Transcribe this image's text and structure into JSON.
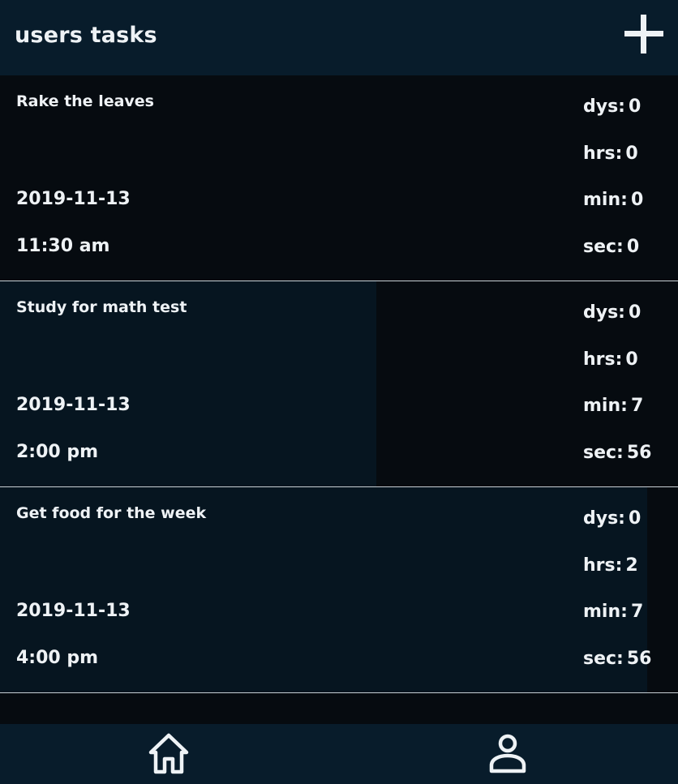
{
  "header": {
    "title": "users tasks",
    "add_icon": "plus-icon"
  },
  "colors": {
    "header_bg": "#081c2b",
    "page_bg": "#060b10",
    "elapsed_fill": "#061520",
    "text": "#eef2f5",
    "divider": "#c8cfd4"
  },
  "tasks": [
    {
      "name": "Rake the leaves",
      "date": "2019-11-13",
      "time": "11:30 am",
      "elapsed_fraction": 0,
      "countdown": {
        "days_label": "dys:",
        "days": "0",
        "hours_label": "hrs:",
        "hours": "0",
        "minutes_label": "min:",
        "minutes": "0",
        "seconds_label": "sec:",
        "seconds": "0"
      }
    },
    {
      "name": "Study for math test",
      "date": "2019-11-13",
      "time": "2:00 pm",
      "elapsed_fraction": 0.555,
      "countdown": {
        "days_label": "dys:",
        "days": "0",
        "hours_label": "hrs:",
        "hours": "0",
        "minutes_label": "min:",
        "minutes": "7",
        "seconds_label": "sec:",
        "seconds": "56"
      }
    },
    {
      "name": "Get food for the week",
      "date": "2019-11-13",
      "time": "4:00 pm",
      "elapsed_fraction": 0.955,
      "countdown": {
        "days_label": "dys:",
        "days": "0",
        "hours_label": "hrs:",
        "hours": "2",
        "minutes_label": "min:",
        "minutes": "7",
        "seconds_label": "sec:",
        "seconds": "56"
      }
    }
  ],
  "nav": {
    "home_icon": "home-icon",
    "profile_icon": "user-icon"
  }
}
